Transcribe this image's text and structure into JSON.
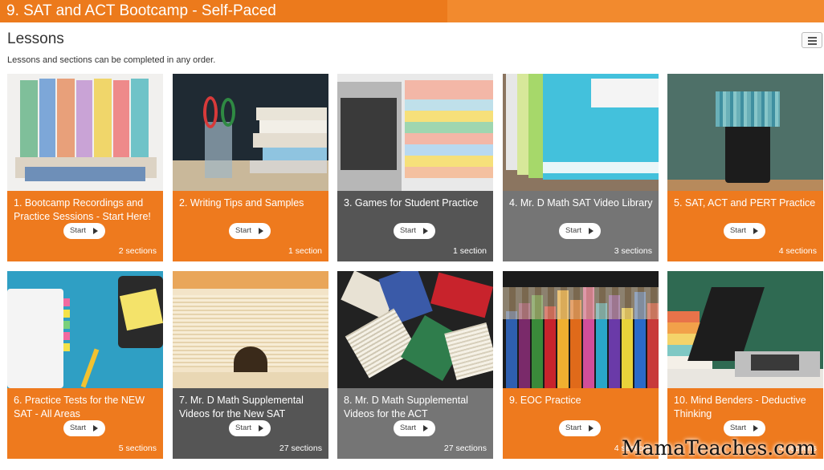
{
  "course": {
    "title": "9. SAT and ACT Bootcamp - Self-Paced"
  },
  "lessons_heading": "Lessons",
  "subtitle": "Lessons and sections can be completed in any order.",
  "start_label": "Start",
  "lessons": [
    {
      "label": "1. Bootcamp Recordings and Practice Sessions - Start Here!",
      "count": "2 sections"
    },
    {
      "label": "2. Writing Tips and Samples",
      "count": "1 section"
    },
    {
      "label": "3. Games for Student Practice",
      "count": "1 section"
    },
    {
      "label": "4. Mr. D Math SAT Video Library",
      "count": "3 sections"
    },
    {
      "label": "5. SAT, ACT and PERT Practice",
      "count": "4 sections"
    },
    {
      "label": "6. Practice Tests for the NEW SAT - All Areas",
      "count": "5 sections"
    },
    {
      "label": "7. Mr. D Math Supplemental Videos for the New SAT",
      "count": "27 sections"
    },
    {
      "label": "8. Mr. D Math Supplemental Videos for the ACT",
      "count": "27 sections"
    },
    {
      "label": "9. EOC Practice",
      "count": "4 sections"
    },
    {
      "label": "10. Mind Benders - Deductive Thinking",
      "count": "4 sections"
    }
  ],
  "watermark": "MamaTeaches.com",
  "colors": {
    "accent": "#ee7a1e",
    "header": "#f28a2e",
    "dark_gray": "#555555",
    "mid_gray": "#757575"
  }
}
